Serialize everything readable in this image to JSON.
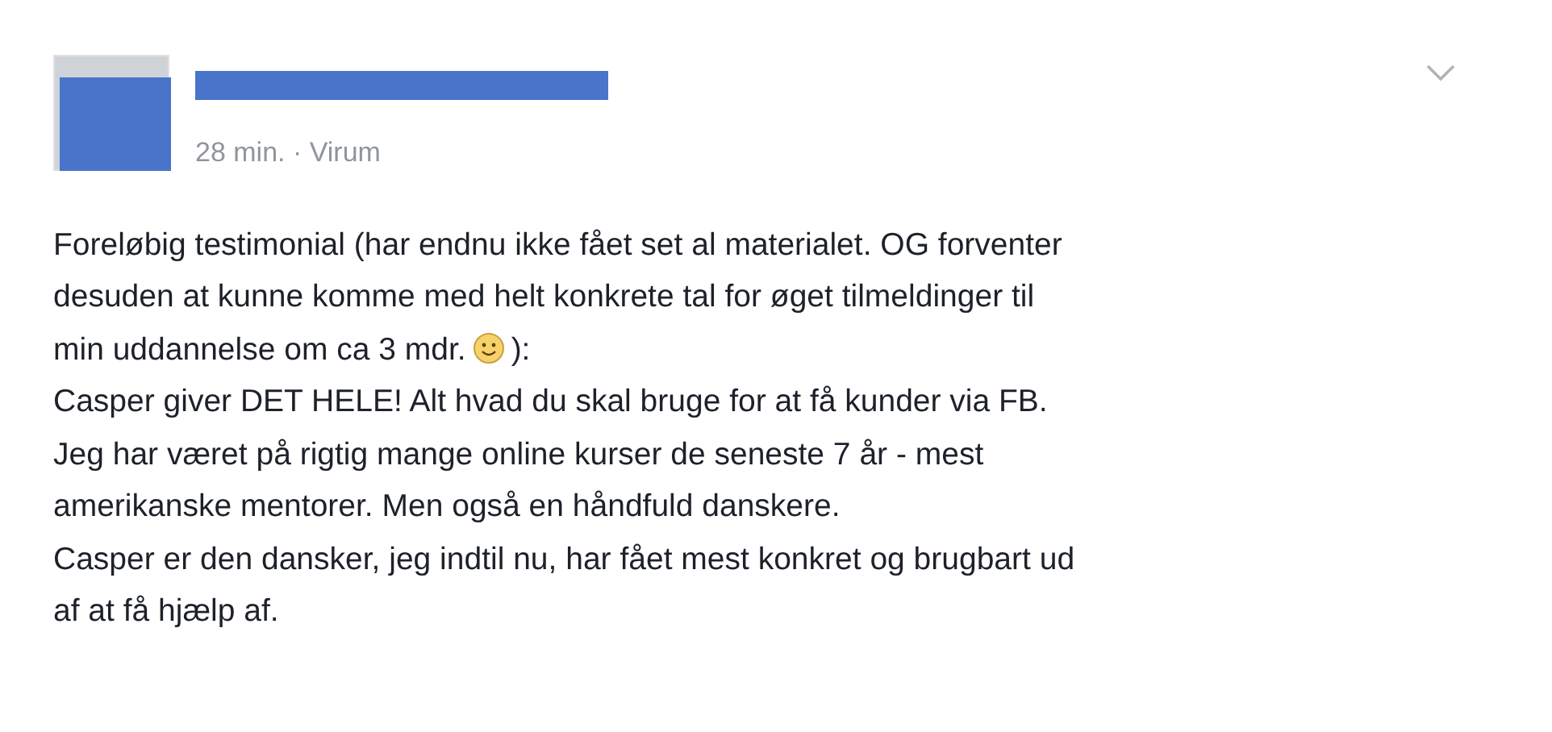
{
  "post": {
    "meta": "28 min. · Virum",
    "lines": [
      {
        "kind": "plain",
        "text": "Foreløbig testimonial (har endnu ikke fået set al materialet. OG forventer"
      },
      {
        "kind": "plain",
        "text": "desuden at kunne komme med helt konkrete tal for øget tilmeldinger til"
      },
      {
        "kind": "smiley",
        "text": "min uddannelse om ca 3 mdr.",
        "after": "):"
      },
      {
        "kind": "plain",
        "text": "Casper giver DET HELE! Alt hvad du skal bruge for at få kunder via FB."
      },
      {
        "kind": "plain",
        "text": "Jeg har været på rigtig mange online kurser de seneste 7 år - mest"
      },
      {
        "kind": "plain",
        "text": "amerikanske mentorer. Men også en håndfuld danskere."
      },
      {
        "kind": "plain",
        "text": "Casper er den dansker, jeg indtil nu, har fået mest konkret og brugbart ud"
      },
      {
        "kind": "plain",
        "text": "af at få hjælp af."
      }
    ]
  }
}
